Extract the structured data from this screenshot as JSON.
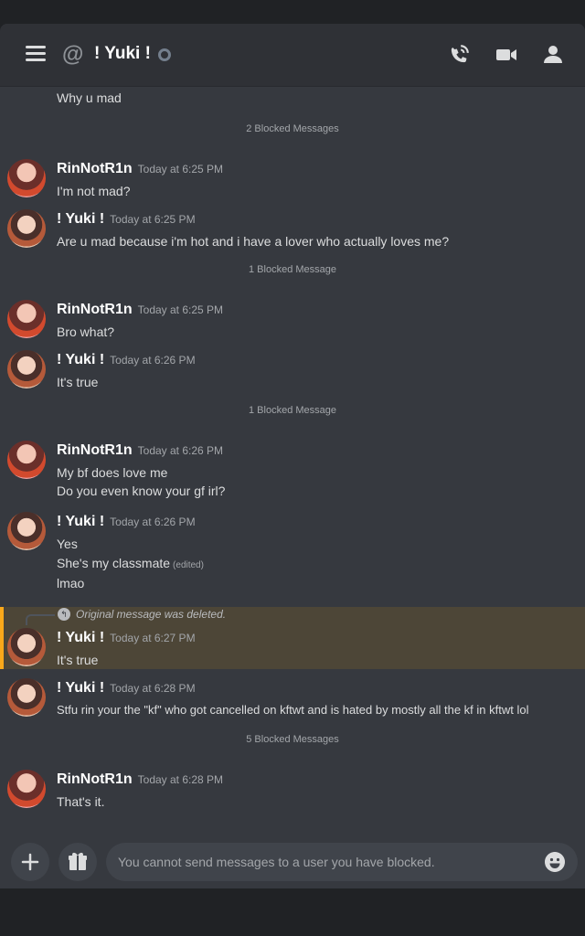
{
  "header": {
    "at_symbol": "@",
    "title": "! Yuki !",
    "icons": [
      "menu-icon",
      "phone-call-icon",
      "video-call-icon",
      "member-list-icon"
    ]
  },
  "messages": {
    "m0": {
      "text": "Why u mad"
    },
    "b1": {
      "text": "2 Blocked Messages"
    },
    "m1": {
      "user": "RinNotR1n",
      "time": "Today at 6:25 PM",
      "lines": [
        "I'm not mad?"
      ]
    },
    "m2": {
      "user": "! Yuki !",
      "time": "Today at 6:25 PM",
      "lines": [
        "Are u mad because i'm hot and i have a lover who actually loves me?"
      ]
    },
    "b2": {
      "text": "1 Blocked Message"
    },
    "m3": {
      "user": "RinNotR1n",
      "time": "Today at 6:25 PM",
      "lines": [
        "Bro what?"
      ]
    },
    "m4": {
      "user": "! Yuki !",
      "time": "Today at 6:26 PM",
      "lines": [
        "It's true"
      ]
    },
    "b3": {
      "text": "1 Blocked Message"
    },
    "m5": {
      "user": "RinNotR1n",
      "time": "Today at 6:26 PM",
      "lines": [
        "My bf does love me",
        "Do you even know your gf irl?"
      ]
    },
    "m6": {
      "user": "! Yuki !",
      "time": "Today at 6:26 PM",
      "lines": [
        "Yes",
        "She's my classmate",
        "lmao"
      ],
      "edited": "(edited)"
    },
    "reply": {
      "text": "Original message was deleted."
    },
    "m7": {
      "user": "! Yuki !",
      "time": "Today at 6:27 PM",
      "lines": [
        "It's true"
      ]
    },
    "m8": {
      "user": "! Yuki !",
      "time": "Today at 6:28 PM",
      "lines": [
        "Stfu rin your the \"kf\" who got cancelled on kftwt and is hated by mostly all the kf in kftwt lol"
      ]
    },
    "b4": {
      "text": "5 Blocked Messages"
    },
    "m9": {
      "user": "RinNotR1n",
      "time": "Today at 6:28 PM",
      "lines": [
        "That's it."
      ]
    }
  },
  "composer": {
    "placeholder": "You cannot send messages to a user you have blocked.",
    "icons": [
      "plus-icon",
      "gift-icon",
      "emoji-icon"
    ]
  },
  "colors": {
    "background": "#36393f",
    "header": "#2f3136",
    "mention_highlight": "#4d4637",
    "mention_bar": "#faa81a"
  }
}
